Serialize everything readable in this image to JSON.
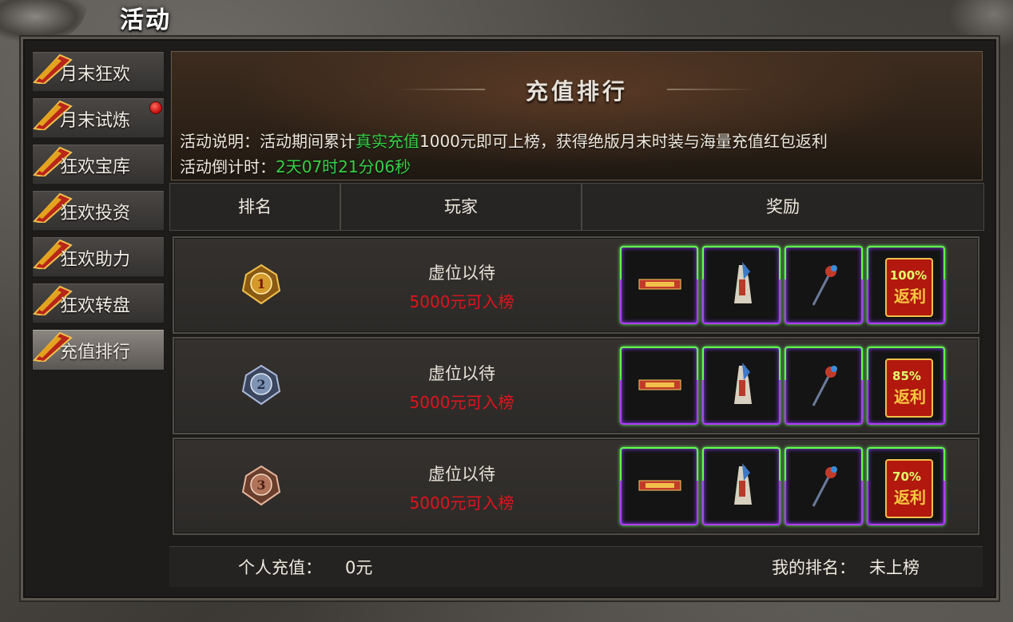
{
  "window": {
    "title": "活动"
  },
  "sidebar": {
    "items": [
      {
        "label": "月末狂欢",
        "active": false,
        "red_dot": false
      },
      {
        "label": "月末试炼",
        "active": false,
        "red_dot": true
      },
      {
        "label": "狂欢宝库",
        "active": false,
        "red_dot": false
      },
      {
        "label": "狂欢投资",
        "active": false,
        "red_dot": false
      },
      {
        "label": "狂欢助力",
        "active": false,
        "red_dot": false
      },
      {
        "label": "狂欢转盘",
        "active": false,
        "red_dot": false
      },
      {
        "label": "充值排行",
        "active": true,
        "red_dot": false
      }
    ]
  },
  "banner": {
    "title": "充值排行",
    "desc_prefix": "活动说明：活动期间累计",
    "desc_highlight": "真实充值",
    "desc_suffix": "1000元即可上榜，获得绝版月末时装与海量充值红包返利",
    "countdown_label": "活动倒计时：",
    "countdown_value": "2天07时21分06秒"
  },
  "table": {
    "headers": {
      "rank": "排名",
      "player": "玩家",
      "reward": "奖励"
    },
    "rows": [
      {
        "rank": "1",
        "player": "虚位以待",
        "requirement": "5000元可入榜",
        "rebate": "100%",
        "rebate_text": "返利"
      },
      {
        "rank": "2",
        "player": "虚位以待",
        "requirement": "5000元可入榜",
        "rebate": "85%",
        "rebate_text": "返利"
      },
      {
        "rank": "3",
        "player": "虚位以待",
        "requirement": "5000元可入榜",
        "rebate": "70%",
        "rebate_text": "返利"
      }
    ]
  },
  "footer": {
    "personal_label": "个人充值：",
    "personal_value": "0元",
    "my_rank_label": "我的排名：",
    "my_rank_value": "未上榜"
  },
  "colors": {
    "accent_green": "#36d247",
    "requirement_red": "#e0141c",
    "gold_medal": "#d59a2c",
    "silver_medal": "#7f93b5",
    "bronze_medal": "#b0745a"
  }
}
